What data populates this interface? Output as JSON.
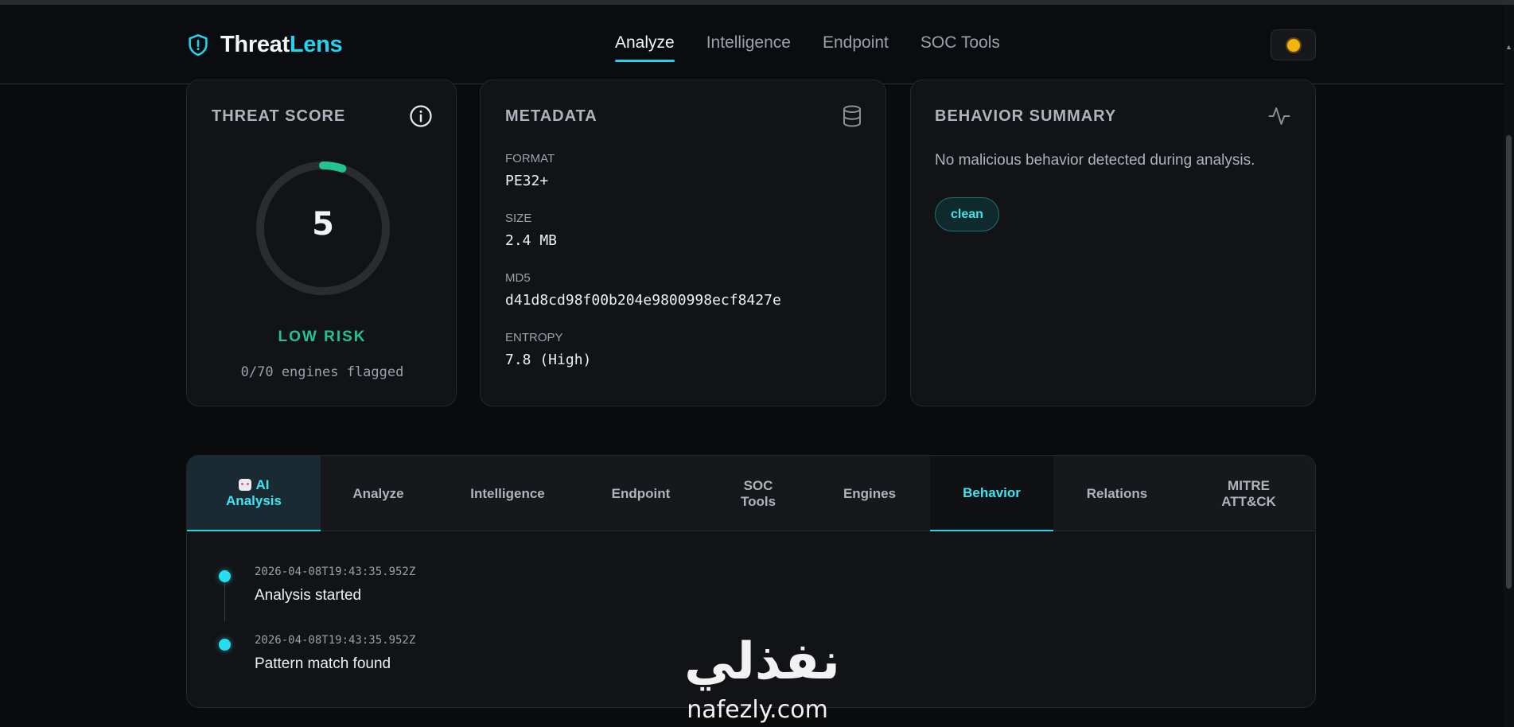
{
  "brand": {
    "part1": "Threat",
    "part2": "Lens"
  },
  "nav": [
    {
      "label": "Analyze",
      "active": true
    },
    {
      "label": "Intelligence",
      "active": false
    },
    {
      "label": "Endpoint",
      "active": false
    },
    {
      "label": "SOC Tools",
      "active": false
    }
  ],
  "colors": {
    "accent": "#22d3ee",
    "low_risk": "#22c48e",
    "background": "#0a0b0d",
    "card": "#121316"
  },
  "score_card": {
    "title": "THREAT SCORE",
    "score": "5",
    "score_value": 5,
    "score_max": 100,
    "risk_label": "LOW RISK",
    "engines_text": "0/70 engines flagged"
  },
  "metadata": {
    "title": "METADATA",
    "fields": [
      {
        "label": "FORMAT",
        "value": "PE32+"
      },
      {
        "label": "SIZE",
        "value": "2.4 MB"
      },
      {
        "label": "MD5",
        "value": "d41d8cd98f00b204e9800998ecf8427e"
      },
      {
        "label": "ENTROPY",
        "value": "7.8 (High)"
      }
    ]
  },
  "behavior": {
    "title": "BEHAVIOR SUMMARY",
    "text": "No malicious behavior detected during analysis.",
    "badge": "clean"
  },
  "tabs": {
    "ai": {
      "line1": "AI",
      "line2": "Analysis"
    },
    "analyze": "Analyze",
    "intelligence": "Intelligence",
    "endpoint": "Endpoint",
    "soc": {
      "line1": "SOC",
      "line2": "Tools"
    },
    "engines": "Engines",
    "behavior": "Behavior",
    "relations": "Relations",
    "mitre": {
      "line1": "MITRE",
      "line2": "ATT&CK"
    }
  },
  "timeline": [
    {
      "time": "2026-04-08T19:43:35.952Z",
      "text": "Analysis started"
    },
    {
      "time": "2026-04-08T19:43:35.952Z",
      "text": "Pattern match found"
    }
  ],
  "watermark": {
    "arabic": "نفذلي",
    "latin": "nafezly.com"
  }
}
